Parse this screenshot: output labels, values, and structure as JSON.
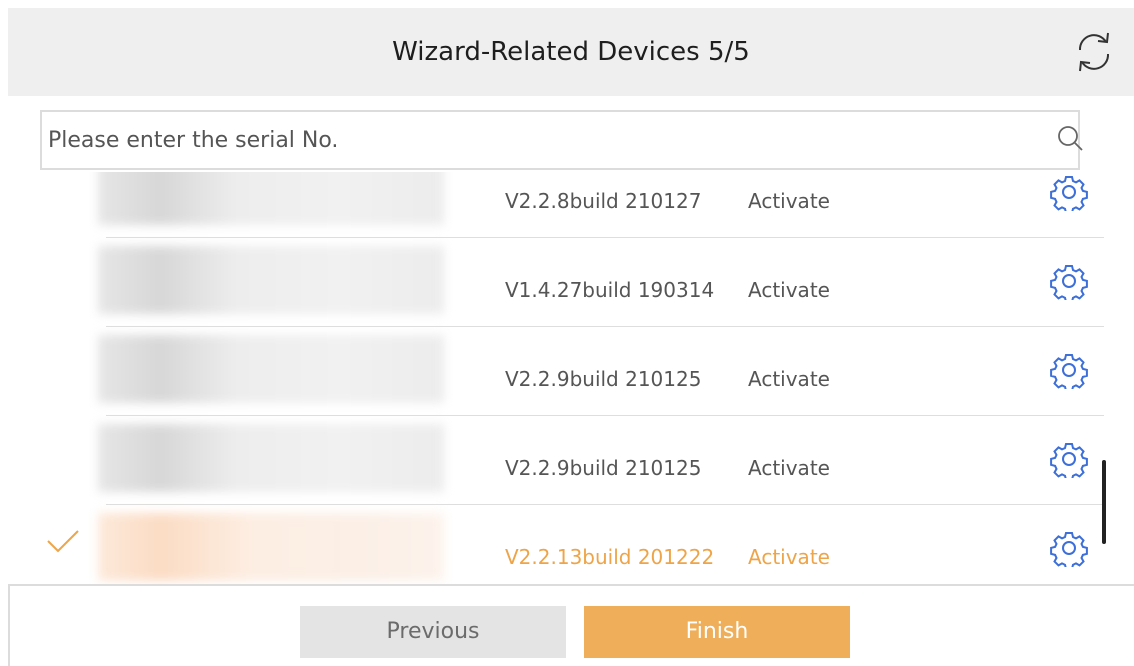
{
  "header": {
    "title": "Wizard-Related Devices 5/5",
    "refresh_icon": "refresh-icon"
  },
  "search": {
    "placeholder": "Please enter the serial No.",
    "value": "",
    "icon": "search-icon"
  },
  "devices": [
    {
      "version": "V2.2.8build 210127",
      "status": "Activate",
      "selected": false
    },
    {
      "version": "V1.4.27build 190314",
      "status": "Activate",
      "selected": false
    },
    {
      "version": "V2.2.9build 210125",
      "status": "Activate",
      "selected": false
    },
    {
      "version": "V2.2.9build 210125",
      "status": "Activate",
      "selected": false
    },
    {
      "version": "V2.2.13build 201222",
      "status": "Activate",
      "selected": true
    }
  ],
  "footer": {
    "previous_label": "Previous",
    "finish_label": "Finish"
  },
  "colors": {
    "accent": "#efae59",
    "selected_text": "#eea448",
    "gear_icon": "#3d6fd8",
    "header_bg": "#efefef"
  }
}
